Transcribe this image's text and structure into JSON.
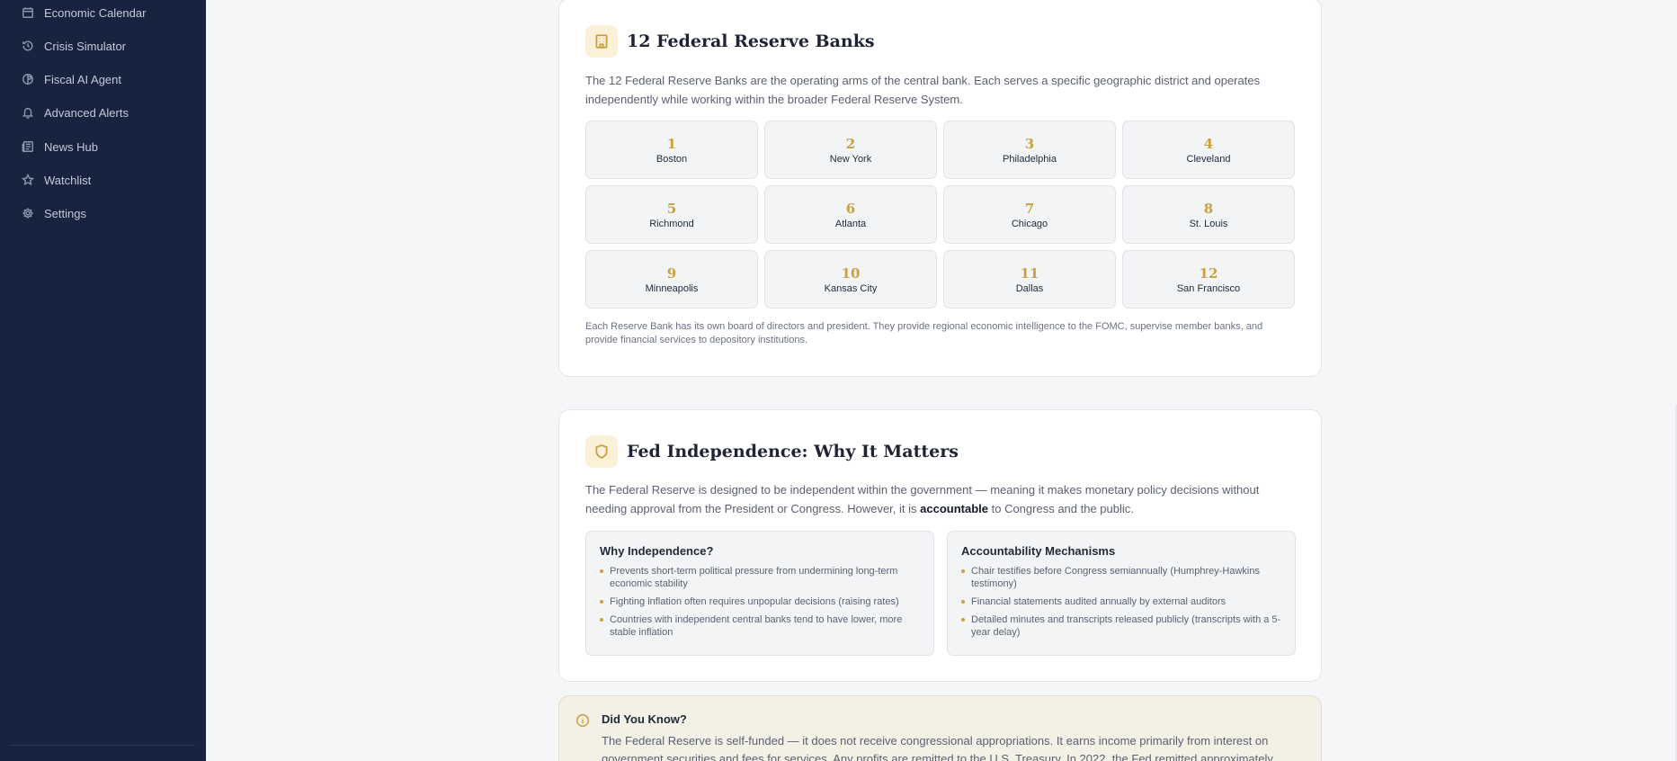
{
  "sidebar": {
    "items": [
      {
        "label": "Economic Calendar",
        "icon": "calendar-icon"
      },
      {
        "label": "Crisis Simulator",
        "icon": "history-icon"
      },
      {
        "label": "Fiscal AI Agent",
        "icon": "ai-agent-icon"
      },
      {
        "label": "Advanced Alerts",
        "icon": "bell-icon"
      },
      {
        "label": "News Hub",
        "icon": "newspaper-icon"
      },
      {
        "label": "Watchlist",
        "icon": "star-icon"
      },
      {
        "label": "Settings",
        "icon": "gear-icon"
      }
    ]
  },
  "banks_card": {
    "title": "12 Federal Reserve Banks",
    "intro": "The 12 Federal Reserve Banks are the operating arms of the central bank. Each serves a specific geographic district and operates independently while working within the broader Federal Reserve System.",
    "banks": [
      {
        "number": "1",
        "city": "Boston"
      },
      {
        "number": "2",
        "city": "New York"
      },
      {
        "number": "3",
        "city": "Philadelphia"
      },
      {
        "number": "4",
        "city": "Cleveland"
      },
      {
        "number": "5",
        "city": "Richmond"
      },
      {
        "number": "6",
        "city": "Atlanta"
      },
      {
        "number": "7",
        "city": "Chicago"
      },
      {
        "number": "8",
        "city": "St. Louis"
      },
      {
        "number": "9",
        "city": "Minneapolis"
      },
      {
        "number": "10",
        "city": "Kansas City"
      },
      {
        "number": "11",
        "city": "Dallas"
      },
      {
        "number": "12",
        "city": "San Francisco"
      }
    ],
    "note": "Each Reserve Bank has its own board of directors and president. They provide regional economic intelligence to the FOMC, supervise member banks, and provide financial services to depository institutions."
  },
  "independence_card": {
    "title": "Fed Independence: Why It Matters",
    "intro_before": "The Federal Reserve is designed to be independent within the government — meaning it makes monetary policy decisions without needing approval from the President or Congress. However, it is ",
    "intro_bold": "accountable",
    "intro_after": " to Congress and the public.",
    "why": {
      "title": "Why Independence?",
      "bullets": [
        "Prevents short-term political pressure from undermining long-term economic stability",
        "Fighting inflation often requires unpopular decisions (raising rates)",
        "Countries with independent central banks tend to have lower, more stable inflation"
      ]
    },
    "accountability": {
      "title": "Accountability Mechanisms",
      "bullets": [
        "Chair testifies before Congress semiannually (Humphrey-Hawkins testimony)",
        "Financial statements audited annually by external auditors",
        "Detailed minutes and transcripts released publicly (transcripts with a 5-year delay)"
      ]
    }
  },
  "did_you_know": {
    "title": "Did You Know?",
    "text": "The Federal Reserve is self-funded — it does not receive congressional appropriations. It earns income primarily from interest on government securities and fees for services. Any profits are remitted to the U.S. Treasury. In 2022, the Fed remitted approximately"
  },
  "colors": {
    "sidebar_bg": "#18233f",
    "accent_gold": "#c9a13f"
  }
}
